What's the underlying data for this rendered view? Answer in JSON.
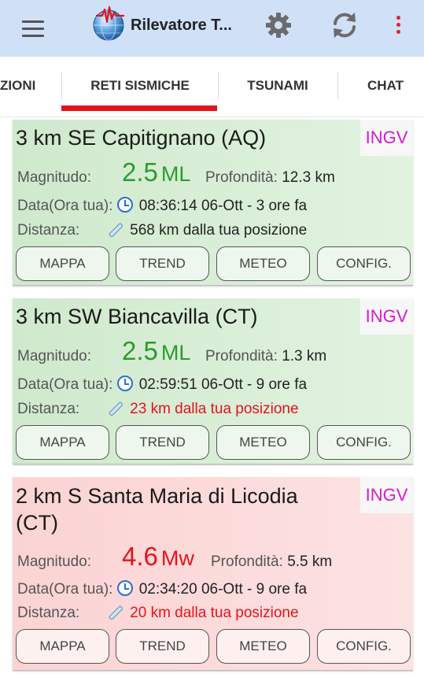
{
  "app": {
    "title": "Rilevatore T..."
  },
  "toolbar": {
    "menu_icon": "hamburger-icon",
    "settings_icon": "gear-icon",
    "refresh_icon": "refresh-icon",
    "overflow_icon": "more-vertical-icon"
  },
  "tabs": [
    {
      "label": "ZIONI",
      "active": false
    },
    {
      "label": "RETI SISMICHE",
      "active": true
    },
    {
      "label": "TSUNAMI",
      "active": false
    },
    {
      "label": "CHAT",
      "active": false
    }
  ],
  "colors": {
    "appbar": "#cfe0f7",
    "tab_indicator": "#e3141c",
    "magnitude_low": "#2a9c2a",
    "magnitude_high": "#e3141c",
    "agency": "#d41ad4"
  },
  "labels": {
    "magnitude": "Magnitudo:",
    "depth": "Profondità:",
    "date": "Data(Ora tua):",
    "distance": "Distanza:"
  },
  "buttons": {
    "map": "MAPPA",
    "trend": "TREND",
    "weather": "METEO",
    "config": "CONFIG."
  },
  "events": [
    {
      "place": "3 km SE Capitignano (AQ)",
      "agency": "INGV",
      "magnitude": "2.5",
      "mag_type": "ML",
      "depth": "12.3 km",
      "datetime": "08:36:14 06-Ott - 3 ore fa",
      "distance": "568 km dalla tua posizione"
    },
    {
      "place": "3 km SW Biancavilla (CT)",
      "agency": "INGV",
      "magnitude": "2.5",
      "mag_type": "ML",
      "depth": "1.3 km",
      "datetime": "02:59:51 06-Ott - 9 ore fa",
      "distance": "23 km dalla tua posizione"
    },
    {
      "place_line1": "2 km S Santa Maria di Licodia",
      "place_line2": "(CT)",
      "agency": "INGV",
      "magnitude": "4.6",
      "mag_type": "Mw",
      "depth": "5.5 km",
      "datetime": "02:34:20 06-Ott - 9 ore fa",
      "distance": "20 km dalla tua posizione"
    }
  ]
}
